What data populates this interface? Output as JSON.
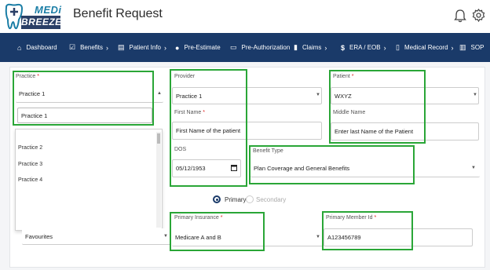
{
  "app": {
    "logo_top": "MEDi",
    "logo_bottom": "BREEZE",
    "title": "Benefit Request",
    "icons": [
      "bell-icon",
      "gear-icon"
    ]
  },
  "nav": [
    {
      "label": "Dashboard",
      "icon": "home-icon"
    },
    {
      "label": "Benefits",
      "icon": "checkbox-icon",
      "chevron": "›"
    },
    {
      "label": "Patient Info",
      "icon": "id-card-icon",
      "chevron": "›"
    },
    {
      "label": "Pre-Estimate",
      "icon": "pin-icon"
    },
    {
      "label": "Pre-Authorization",
      "icon": "monitor-icon"
    },
    {
      "label": "Claims",
      "icon": "clipboard-icon",
      "chevron": "›"
    },
    {
      "label": "ERA / EOB",
      "icon": "dollar-icon",
      "chevron": "›"
    },
    {
      "label": "Medical Record",
      "icon": "document-icon",
      "chevron": "›"
    },
    {
      "label": "SOP",
      "icon": "book-icon"
    }
  ],
  "form": {
    "practice": {
      "label": "Practice",
      "required": "*",
      "value": "Practice 1",
      "search_value": "Practice 1"
    },
    "practice_options": [
      "Practice 2",
      "Practice 3",
      "Practice 4"
    ],
    "favourites": {
      "value": "Favourites"
    },
    "provider": {
      "label": "Provider",
      "value": "Practice 1"
    },
    "first_name": {
      "label": "First Name",
      "required": "*",
      "value": "First Name of the patient"
    },
    "dos": {
      "label": "DOS",
      "value": "05/12/1953"
    },
    "patient": {
      "label": "Patient",
      "required": "*",
      "value": "WXYZ"
    },
    "middle_name": {
      "label": "Middle Name",
      "value": "Enter last Name of the Patient"
    },
    "benefit_type": {
      "label": "Benefit Type",
      "value": "Plan Coverage and General Benefits"
    },
    "coverage": {
      "primary": "Primary",
      "secondary": "Secondary",
      "selected": "Primary"
    },
    "primary_insurance": {
      "label": "Primary Insurance",
      "required": "*",
      "value": "Medicare A and B"
    },
    "primary_member_id": {
      "label": "Primary Member Id",
      "required": "*",
      "value": "A123456789"
    }
  },
  "colors": {
    "nav_bg": "#1a3a69",
    "highlight": "#2aa637",
    "required": "#d22"
  }
}
